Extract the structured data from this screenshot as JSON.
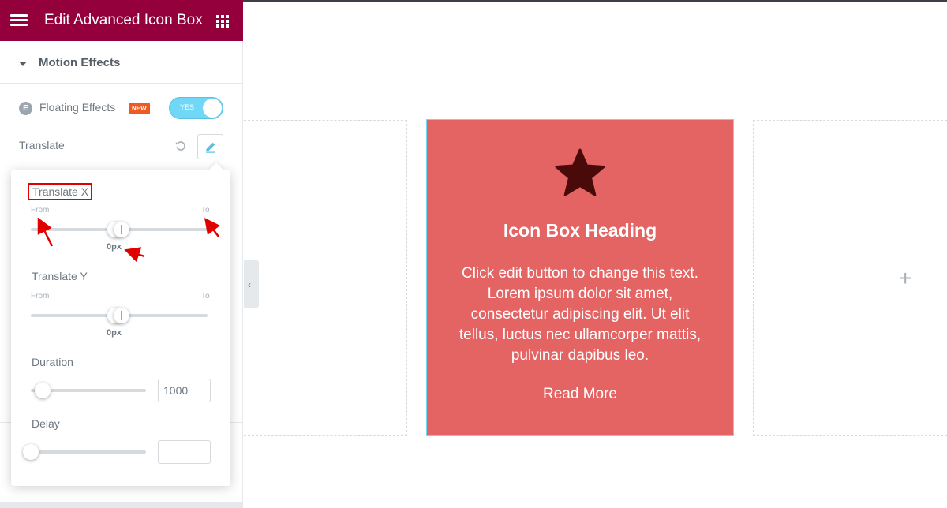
{
  "header": {
    "title": "Edit Advanced Icon Box"
  },
  "section": {
    "title": "Motion Effects"
  },
  "floating": {
    "badge_letter": "E",
    "label": "Floating Effects",
    "new_badge": "NEW",
    "toggle_text": "YES",
    "toggle_on": true
  },
  "translate": {
    "label": "Translate"
  },
  "popover": {
    "translate_x": {
      "label": "Translate X",
      "from_label": "From",
      "to_label": "To",
      "value": "0px"
    },
    "translate_y": {
      "label": "Translate Y",
      "from_label": "From",
      "to_label": "To",
      "value": "0px"
    },
    "duration": {
      "label": "Duration",
      "value": "1000"
    },
    "delay": {
      "label": "Delay",
      "value": ""
    }
  },
  "icon_box": {
    "heading": "Icon Box Heading",
    "text": "Click edit button to change this text. Lorem ipsum dolor sit amet, consectetur adipiscing elit. Ut elit tellus, luctus nec ullamcorper mattis, pulvinar dapibus leo.",
    "read_more": "Read More",
    "background": "#e46464",
    "star_color": "#4a0a0a"
  },
  "colors": {
    "header_bg": "#93003c",
    "toggle_on": "#71d7f7",
    "annotation_red": "#e00000"
  }
}
